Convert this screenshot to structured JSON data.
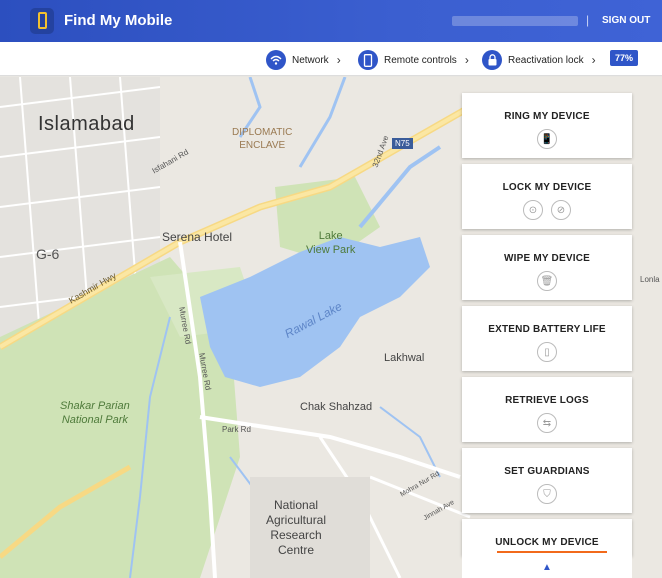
{
  "header": {
    "app_title": "Find My Mobile",
    "separator": "|",
    "signout_label": "SIGN OUT"
  },
  "toolbar": {
    "network_label": "Network",
    "remote_label": "Remote controls",
    "reactivation_label": "Reactivation lock",
    "battery": "77%"
  },
  "map": {
    "labels": {
      "islamabad": "Islamabad",
      "diplomatic1": "DIPLOMATIC",
      "diplomatic2": "ENCLAVE",
      "serena": "Serena Hotel",
      "g6": "G-6",
      "kashmir": "Kashmir Hwy",
      "lakeview1": "Lake",
      "lakeview2": "View Park",
      "rawal": "Rawal Lake",
      "lakhwal": "Lakhwal",
      "chak": "Chak Shahzad",
      "shakar1": "Shakar Parian",
      "shakar2": "National Park",
      "park": "Park Rd",
      "murree1": "Murree Rd",
      "murree2": "Murree Rd",
      "n75": "N75",
      "isfahani": "Isfahani Rd",
      "nari1": "National",
      "nari2": "Agricultural",
      "nari3": "Research",
      "nari4": "Centre",
      "mohra": "Mohra Nur Rd",
      "jinnah": "Jinnah Ave",
      "ave32": "32nd Ave",
      "lonla": "Lonla"
    }
  },
  "panels": [
    {
      "title": "RING MY DEVICE"
    },
    {
      "title": "LOCK MY DEVICE"
    },
    {
      "title": "WIPE MY DEVICE"
    },
    {
      "title": "EXTEND BATTERY LIFE"
    },
    {
      "title": "RETRIEVE LOGS"
    },
    {
      "title": "SET GUARDIANS"
    },
    {
      "title": "UNLOCK MY DEVICE"
    }
  ]
}
